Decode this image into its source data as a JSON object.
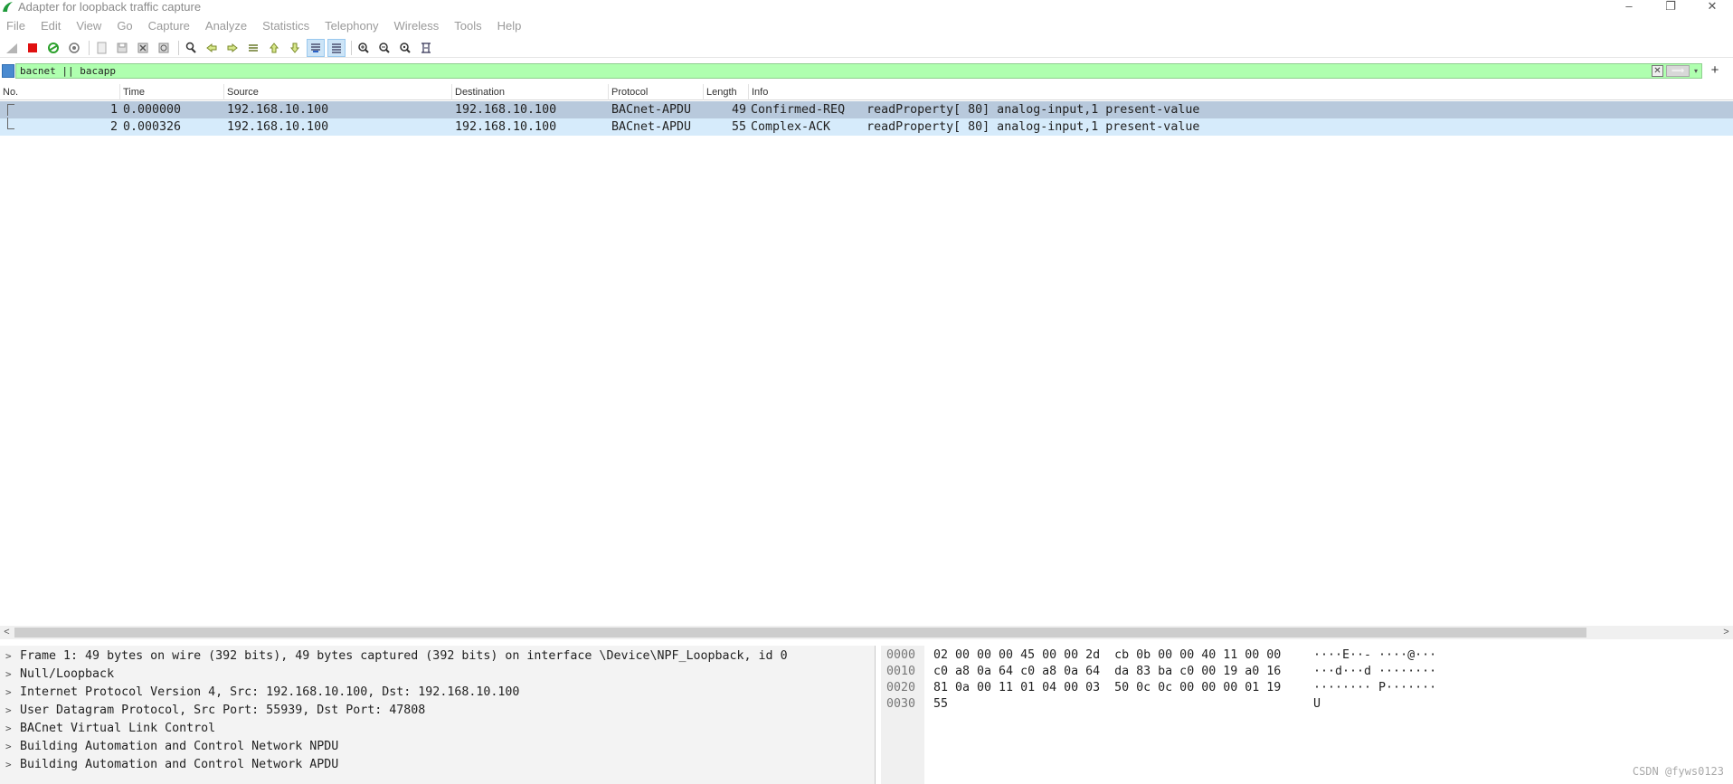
{
  "window": {
    "title": "Adapter for loopback traffic capture",
    "controls": [
      "–",
      "❐",
      "✕"
    ]
  },
  "menu": [
    "File",
    "Edit",
    "View",
    "Go",
    "Capture",
    "Analyze",
    "Statistics",
    "Telephony",
    "Wireless",
    "Tools",
    "Help"
  ],
  "toolbar": {
    "icons": [
      "shark-fin-start-icon",
      "stop-capture-icon",
      "restart-capture-icon",
      "capture-options-icon",
      "open-file-icon",
      "save-file-icon",
      "close-file-icon",
      "reload-file-icon",
      "find-packet-icon",
      "go-back-icon",
      "go-forward-icon",
      "go-to-packet-icon",
      "go-first-icon",
      "go-last-icon",
      "autoscroll-icon",
      "colorize-icon",
      "zoom-in-icon",
      "zoom-out-icon",
      "zoom-normal-icon",
      "resize-columns-icon"
    ]
  },
  "filter": {
    "value": "bacnet || bacapp",
    "apply_label": "⟹",
    "dropdown_label": "▾",
    "add_label": "+",
    "clear_label": "✕",
    "color": "#afffaf"
  },
  "packet_list": {
    "columns": [
      "No.",
      "Time",
      "Source",
      "Destination",
      "Protocol",
      "Length",
      "Info"
    ],
    "rows": [
      {
        "no": "1",
        "time": "0.000000",
        "source": "192.168.10.100",
        "destination": "192.168.10.100",
        "protocol": "BACnet-APDU",
        "length": "49",
        "info": "Confirmed-REQ   readProperty[ 80] analog-input,1 present-value"
      },
      {
        "no": "2",
        "time": "0.000326",
        "source": "192.168.10.100",
        "destination": "192.168.10.100",
        "protocol": "BACnet-APDU",
        "length": "55",
        "info": "Complex-ACK     readProperty[ 80] analog-input,1 present-value"
      }
    ]
  },
  "detail_tree": [
    "Frame 1: 49 bytes on wire (392 bits), 49 bytes captured (392 bits) on interface \\Device\\NPF_Loopback, id 0",
    "Null/Loopback",
    "Internet Protocol Version 4, Src: 192.168.10.100, Dst: 192.168.10.100",
    "User Datagram Protocol, Src Port: 55939, Dst Port: 47808",
    "BACnet Virtual Link Control",
    "Building Automation and Control Network NPDU",
    "Building Automation and Control Network APDU"
  ],
  "bytes": [
    {
      "offset": "0000",
      "hex": "02 00 00 00 45 00 00 2d  cb 0b 00 00 40 11 00 00",
      "ascii": "····E··- ····@···"
    },
    {
      "offset": "0010",
      "hex": "c0 a8 0a 64 c0 a8 0a 64  da 83 ba c0 00 19 a0 16",
      "ascii": "···d···d ········"
    },
    {
      "offset": "0020",
      "hex": "81 0a 00 11 01 04 00 03  50 0c 0c 00 00 00 01 19",
      "ascii": "········ P·······"
    },
    {
      "offset": "0030",
      "hex": "55",
      "ascii": "U"
    }
  ],
  "watermark": "CSDN @fyws0123",
  "scroll": {
    "left": "<",
    "right": ">"
  }
}
